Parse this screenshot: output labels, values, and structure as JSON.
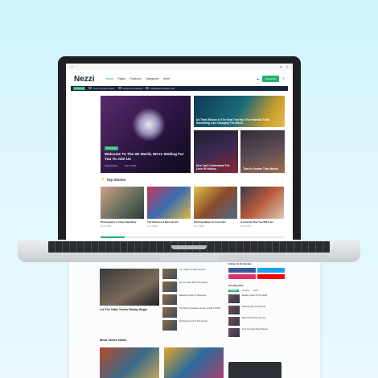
{
  "site": {
    "logo": "Nezzi",
    "nav": [
      "Home",
      "Pages",
      "Features",
      "Categories",
      "More"
    ],
    "subscribe_label": "Subscribe",
    "ticker": [
      "Trending",
      "Iconic Porsche Racer",
      "Guests Fun Allowed",
      "Newspaper Edition This"
    ]
  },
  "hero": {
    "category": "Technology",
    "title": "Welcome To The 3D World, We're Waiting For You To Join Us",
    "author": "Johanna Ryan",
    "date": "Jan 14 2022"
  },
  "cards": [
    {
      "title": "Do Think Bitcoin Is The Gem That Has The Potential To Be Something Like Changing The World"
    },
    {
      "title": "Kris Can't Understand The Love Of Hockey"
    },
    {
      "title": "Time Is Greater Than Money"
    }
  ],
  "top_stories": {
    "heading": "Top Stories",
    "arrows": "‹ ›",
    "items": [
      {
        "title": "Photography Is About Simplicity",
        "date": "Jan 12 2022"
      },
      {
        "title": "You'll Believe A Man Can Fly",
        "date": "Jan 13 2022"
      },
      {
        "title": "Painting Makes Us Feel Alive",
        "date": "Jan 13 2022"
      },
      {
        "title": "A Lifestyle That You Will Love",
        "date": "Jan 14 2022"
      }
    ]
  },
  "background_page": {
    "featured_title": "Let The Table Tennis Rivalry Begin",
    "list": [
      "Am I Sport Or Other Sports?",
      "Do You Can't Miss This Places",
      "Beautiful Guide To Adventure",
      "The Most Impressive Hockey Guide Of 2022",
      "Do Dog Are Living The Animal"
    ],
    "sidebar_heading": "Follow Us On Socials",
    "popular_heading": "Trending Now",
    "tabs": [
      "Popular",
      "Trending",
      "Latest"
    ],
    "popular": [
      "Breaking News Of This Week",
      "Wearing Apply To Play Now",
      "Best Of Permanent Pictures",
      "Tech Gets Start Talent Review"
    ],
    "most_viewed": "Most Views News"
  },
  "colors": {
    "accent": "#23b26d",
    "dark": "#14243a"
  }
}
